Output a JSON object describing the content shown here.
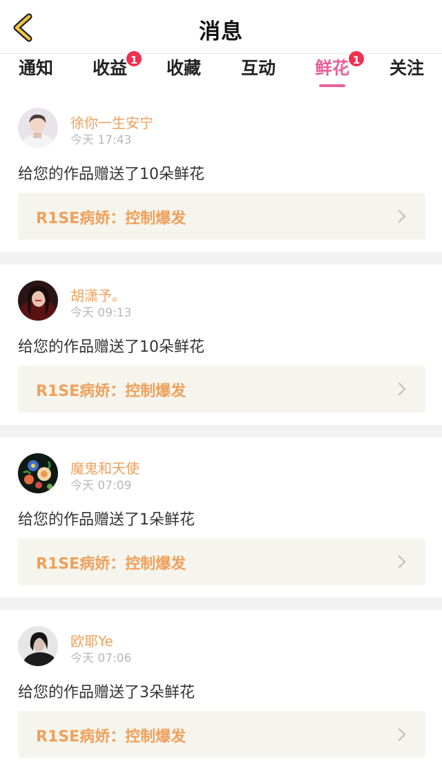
{
  "header": {
    "title": "消息"
  },
  "tabs": [
    {
      "label": "通知",
      "badge": ""
    },
    {
      "label": "收益",
      "badge": "1"
    },
    {
      "label": "收藏",
      "badge": ""
    },
    {
      "label": "互动",
      "badge": ""
    },
    {
      "label": "鲜花",
      "badge": "1",
      "active": true
    },
    {
      "label": "关注",
      "badge": ""
    }
  ],
  "messages": [
    {
      "user": "徐你一生安宁",
      "time": "今天 17:43",
      "text": "给您的作品赠送了10朵鲜花",
      "work": "R1SE病娇：控制爆发",
      "avatar": "avatar-boy"
    },
    {
      "user": "胡潇予。",
      "time": "今天 09:13",
      "text": "给您的作品赠送了10朵鲜花",
      "work": "R1SE病娇：控制爆发",
      "avatar": "avatar-girl-red"
    },
    {
      "user": "魔鬼和天使",
      "time": "今天 07:09",
      "text": "给您的作品赠送了1朵鲜花",
      "work": "R1SE病娇：控制爆发",
      "avatar": "avatar-flowers"
    },
    {
      "user": "欧耶Ye",
      "time": "今天 07:06",
      "text": "给您的作品赠送了3朵鲜花",
      "work": "R1SE病娇：控制爆发",
      "avatar": "avatar-dark"
    }
  ],
  "colors": {
    "accent": "#e8609a",
    "username": "#f0a05c",
    "badge": "#f0304f",
    "work_bg": "#f6f5ed"
  }
}
